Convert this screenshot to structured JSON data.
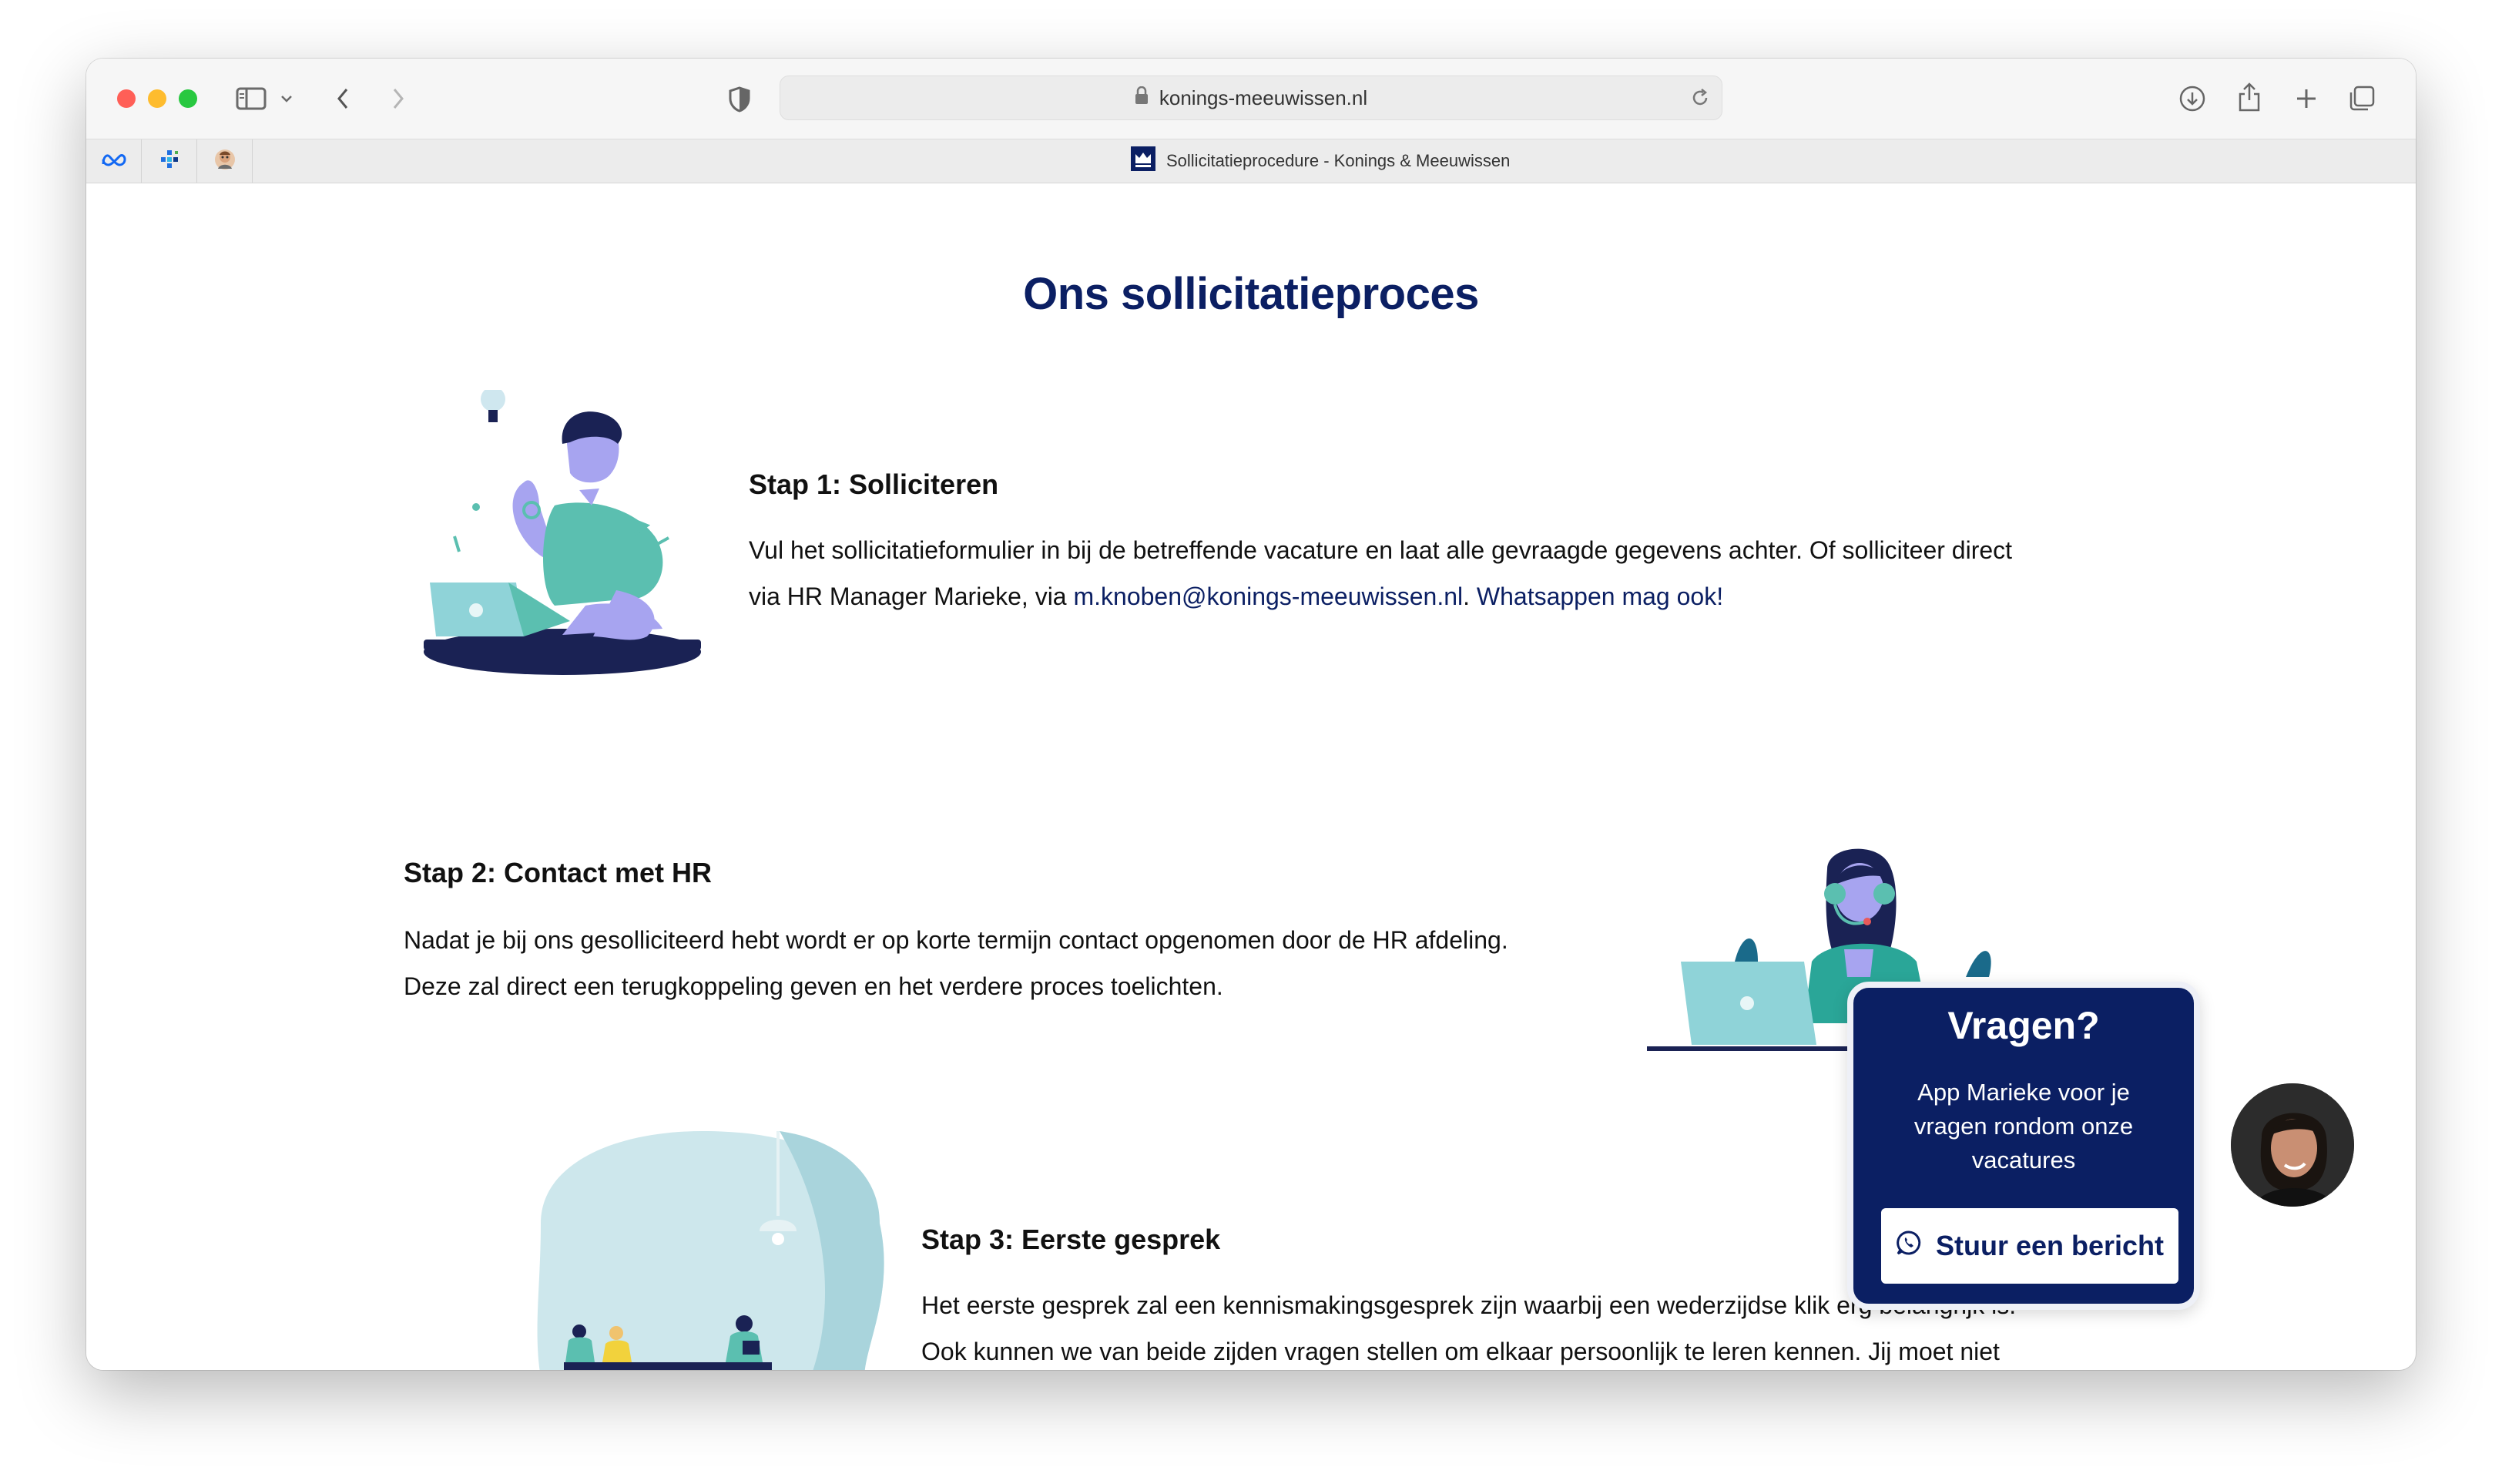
{
  "browser": {
    "url": "konings-meeuwissen.nl",
    "tab_title": "Sollicitatieprocedure - Konings & Meeuwissen",
    "pinned_tabs": [
      "meta-icon",
      "tile-app-icon",
      "avatar-icon"
    ]
  },
  "page": {
    "heading": "Ons sollicitatieproces",
    "step1": {
      "title": "Stap 1: Solliciteren",
      "text_line1": "Vul het sollicitatieformulier in bij de betreffende vacature en laat alle gevraagde gegevens achter. Of solliciteer direct",
      "text_line2_prefix": "via HR Manager Marieke, via ",
      "email": "m.knoben@konings-meeuwissen.nl",
      "separator": ". ",
      "whatsapp_link": "Whatsappen mag ook!"
    },
    "step2": {
      "title": "Stap 2: Contact met HR",
      "text_line1": "Nadat je bij ons gesolliciteerd hebt wordt er op korte termijn contact opgenomen door de HR afdeling.",
      "text_line2": "Deze zal direct een terugkoppeling geven en het verdere proces toelichten."
    },
    "step3": {
      "title": "Stap 3: Eerste gesprek",
      "text_line1": "Het eerste gesprek zal een kennismakingsgesprek zijn waarbij een wederzijdse klik erg belangrijk is.",
      "text_line2": "Ook kunnen we van beide zijden vragen stellen om elkaar persoonlijk te leren kennen. Jij moet niet"
    }
  },
  "chat_widget": {
    "title": "Vragen?",
    "text": "App Marieke voor je vragen rondom onze vacatures",
    "button_label": "Stuur een bericht"
  },
  "colors": {
    "brand_navy": "#0b1f63",
    "teal": "#5bbfb0",
    "lavender": "#a7a4f0"
  }
}
